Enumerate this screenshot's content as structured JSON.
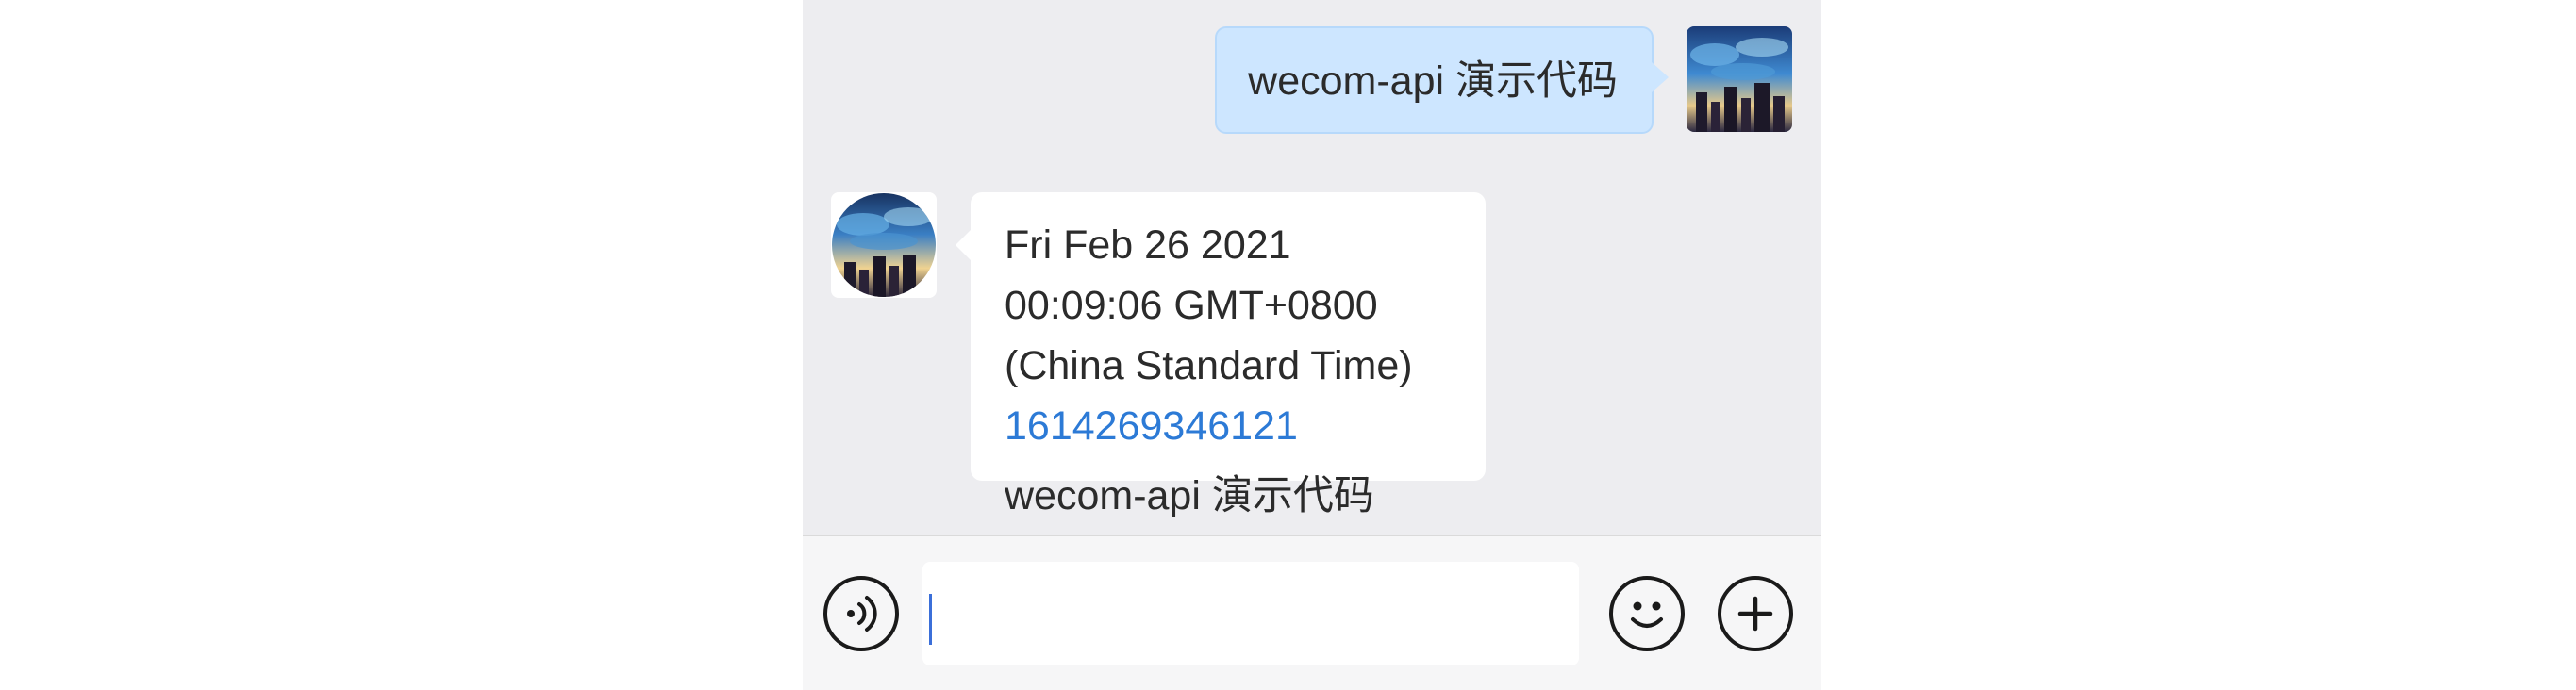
{
  "conversation": {
    "outgoing_message": {
      "text": "wecom-api 演示代码",
      "avatar_icon": "night-cityscape-avatar"
    },
    "incoming_message": {
      "date_text": "Fri Feb 26 2021 00:09:06 GMT+0800 (China Standard Time) ",
      "timestamp": "1614269346121",
      "body_text": "wecom-api 演示代码",
      "avatar_icon": "night-cityscape-avatar-round"
    }
  },
  "composer": {
    "input_value": "",
    "voice_icon": "voice-input-icon",
    "emoji_icon": "emoji-icon",
    "plus_icon": "plus-icon"
  },
  "colors": {
    "outgoing_bubble": "#cde6ff",
    "incoming_bubble": "#ffffff",
    "link": "#2c7ad6",
    "chat_background": "#ededf0",
    "caret": "#3b6fd9"
  }
}
